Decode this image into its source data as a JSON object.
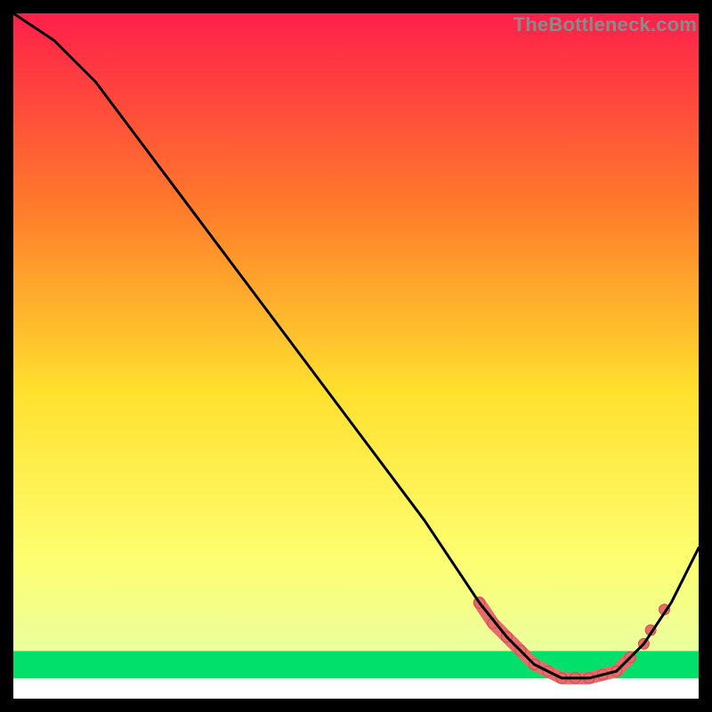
{
  "watermark": "TheBottleneck.com",
  "colors": {
    "gradient_top": "#ff1f4b",
    "gradient_mid1": "#ff8a2a",
    "gradient_mid2": "#ffe02e",
    "gradient_mid3": "#fbff6a",
    "gradient_bottom_band": "#00e06a",
    "line": "#000000",
    "marker_fill": "#e86a6a",
    "marker_stroke": "#c94f4f"
  },
  "chart_data": {
    "type": "line",
    "title": "",
    "xlabel": "",
    "ylabel": "",
    "xlim": [
      0,
      100
    ],
    "ylim": [
      0,
      100
    ],
    "grid": false,
    "legend": false,
    "series": [
      {
        "name": "curve",
        "x": [
          0,
          6,
          12,
          18,
          24,
          30,
          36,
          42,
          48,
          54,
          60,
          64,
          68,
          72,
          76,
          80,
          84,
          88,
          92,
          96,
          100
        ],
        "y": [
          100,
          96,
          90,
          82,
          74,
          66,
          58,
          50,
          42,
          34,
          26,
          20,
          14,
          9,
          5,
          3,
          3,
          4,
          8,
          14,
          22
        ]
      }
    ],
    "markers": {
      "name": "highlight-band",
      "x": [
        68,
        70,
        72,
        74,
        76,
        78,
        80,
        82,
        84,
        86,
        88,
        90,
        92,
        93,
        95
      ],
      "y": [
        14,
        11,
        9,
        7,
        5,
        4,
        3,
        3,
        3,
        3.5,
        4,
        6,
        8,
        10,
        13
      ]
    }
  }
}
